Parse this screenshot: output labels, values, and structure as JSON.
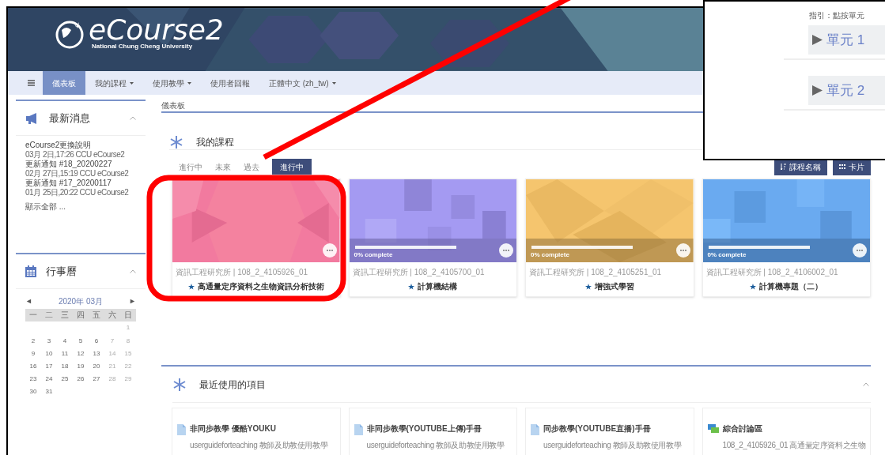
{
  "header": {
    "logo": "eCourse2",
    "subtitle": "National Chung Cheng University"
  },
  "nav": [
    {
      "label": "儀表板",
      "selected": true,
      "has_menu": false
    },
    {
      "label": "我的課程",
      "selected": false,
      "has_menu": true
    },
    {
      "label": "使用教學",
      "selected": false,
      "has_menu": true
    },
    {
      "label": "使用者回報",
      "selected": false,
      "has_menu": false
    },
    {
      "label": "正體中文 (zh_tw)",
      "selected": false,
      "has_menu": true
    }
  ],
  "news": {
    "title": "最新消息",
    "items": [
      {
        "title": "eCourse2更換說明",
        "meta": "03月 2日,17:26 CCU eCourse2"
      },
      {
        "title": "更新通知 #18_20200227",
        "meta": "02月 27日,15:19 CCU eCourse2"
      },
      {
        "title": "更新通知 #17_20200117",
        "meta": "01月 25日,20:22 CCU eCourse2"
      }
    ],
    "show_all": "顯示全部 ..."
  },
  "calendar": {
    "title": "行事曆",
    "prev": "◄",
    "month": "2020年 03月",
    "next": "►",
    "weekdays": [
      "一",
      "二",
      "三",
      "四",
      "五",
      "六",
      "日"
    ],
    "weeks": [
      [
        "1"
      ],
      [
        "2",
        "3",
        "4",
        "5",
        "6",
        "7",
        "8"
      ],
      [
        "9",
        "10",
        "11",
        "12",
        "13",
        "14",
        "15"
      ],
      [
        "16",
        "17",
        "18",
        "19",
        "20",
        "21",
        "22"
      ],
      [
        "23",
        "24",
        "25",
        "26",
        "27",
        "28",
        "29"
      ],
      [
        "30",
        "31"
      ]
    ]
  },
  "breadcrumb": "儀表板",
  "my_courses": {
    "title": "我的課程",
    "tabs": [
      {
        "label": "進行中",
        "selected": false
      },
      {
        "label": "未來",
        "selected": false
      },
      {
        "label": "過去",
        "selected": false
      }
    ],
    "filter": "進行中",
    "sort_button": "課程名稱",
    "view_button": "卡片",
    "courses": [
      {
        "category": "資訊工程研究所 | 108_2_4105926_01",
        "name": "高通量定序資料之生物資訊分析技術",
        "starred": true
      },
      {
        "category": "資訊工程研究所 | 108_2_4105700_01",
        "name": "計算機結構",
        "starred": true,
        "progress": "0% complete",
        "level": 0
      },
      {
        "category": "資訊工程研究所 | 108_2_4105251_01",
        "name": "增強式學習",
        "starred": true,
        "progress": "0% complete",
        "level": 0
      },
      {
        "category": "資訊工程研究所 | 108_2_4106002_01",
        "name": "計算機專題（二）",
        "starred": true,
        "progress": "0% complete",
        "level": 0
      }
    ]
  },
  "recent": {
    "title": "最近使用的項目",
    "items": [
      {
        "kind": "page",
        "title": "非同步教學 優酷YOUKU",
        "subtitle": "userguideforteaching 教師及助教使用教學"
      },
      {
        "kind": "page",
        "title": "非同步教學(YOUTUBE上傳)手冊",
        "subtitle": "userguideforteaching 教師及助教使用教學"
      },
      {
        "kind": "page",
        "title": "同步教學(YOUTUBE直播)手冊",
        "subtitle": "userguideforteaching 教師及助教使用教學"
      },
      {
        "kind": "forum",
        "title": "綜合討論區",
        "subtitle": "108_2_4105926_01 高通量定序資料之生物"
      }
    ]
  },
  "inset": {
    "hint": "指引：點按單元",
    "units": [
      "單元 1",
      "單元 2"
    ]
  }
}
